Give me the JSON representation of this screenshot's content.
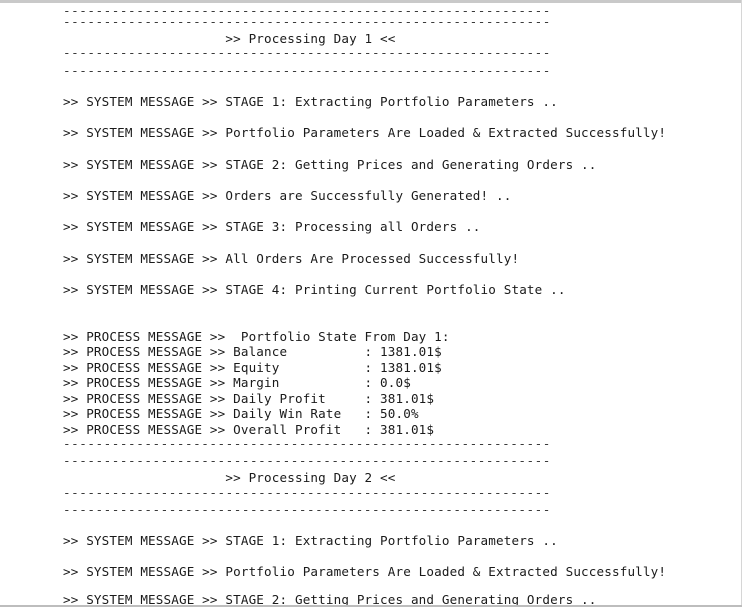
{
  "dash": "------------------------------------------------------------",
  "day1": {
    "header": "                     >> Processing Day 1 <<",
    "stage1": ">> SYSTEM MESSAGE >> STAGE 1: Extracting Portfolio Parameters ..",
    "loaded": ">> SYSTEM MESSAGE >> Portfolio Parameters Are Loaded & Extracted Successfully!",
    "stage2": ">> SYSTEM MESSAGE >> STAGE 2: Getting Prices and Generating Orders ..",
    "generated": ">> SYSTEM MESSAGE >> Orders are Successfully Generated! ..",
    "stage3": ">> SYSTEM MESSAGE >> STAGE 3: Processing all Orders ..",
    "processed": ">> SYSTEM MESSAGE >> All Orders Are Processed Successfully!",
    "stage4": ">> SYSTEM MESSAGE >> STAGE 4: Printing Current Portfolio State ..",
    "state_header": ">> PROCESS MESSAGE >>  Portfolio State From Day 1:",
    "balance": ">> PROCESS MESSAGE >> Balance          : 1381.01$",
    "equity": ">> PROCESS MESSAGE >> Equity           : 1381.01$",
    "margin": ">> PROCESS MESSAGE >> Margin           : 0.0$",
    "daily_profit": ">> PROCESS MESSAGE >> Daily Profit     : 381.01$",
    "win_rate": ">> PROCESS MESSAGE >> Daily Win Rate   : 50.0%",
    "overall_profit": ">> PROCESS MESSAGE >> Overall Profit   : 381.01$"
  },
  "day2": {
    "header": "                     >> Processing Day 2 <<",
    "stage1": ">> SYSTEM MESSAGE >> STAGE 1: Extracting Portfolio Parameters ..",
    "loaded": ">> SYSTEM MESSAGE >> Portfolio Parameters Are Loaded & Extracted Successfully!",
    "stage2": ">> SYSTEM MESSAGE >> STAGE 2: Getting Prices and Generating Orders .."
  }
}
